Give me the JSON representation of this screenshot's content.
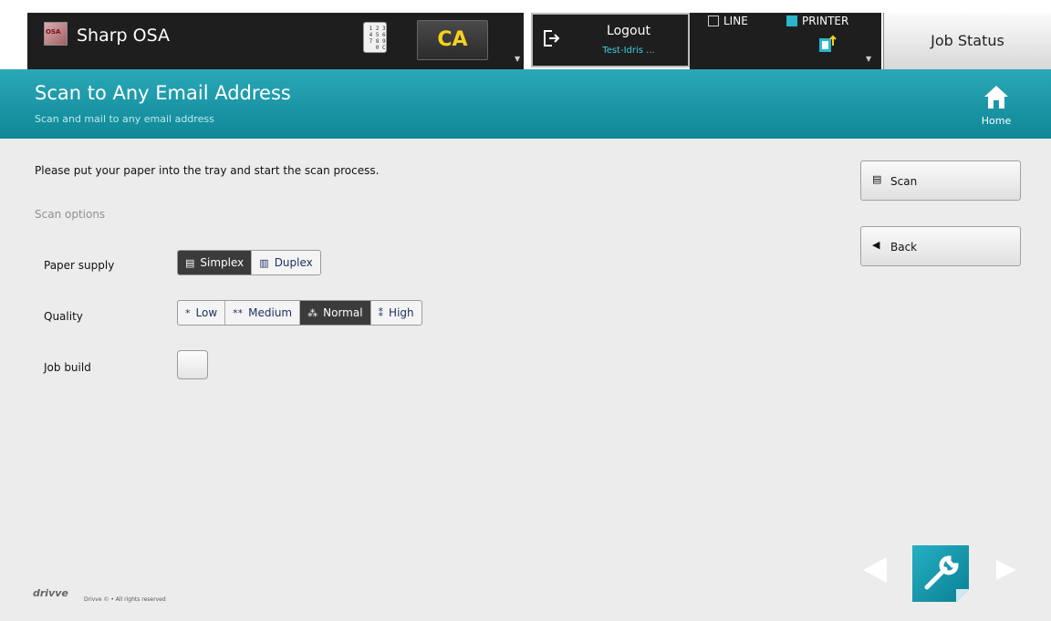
{
  "top_bar": {
    "app_title": "Sharp OSA",
    "app_logo_text": "OSA",
    "keypad_icon": "keypad-icon",
    "keypad_text": " 1 2 3\n 4 5 6\n 7 8 9\n   0 C",
    "ca_label": "CA",
    "logout_label": "Logout",
    "logout_user": "Test-Idris ...",
    "line_label": "LINE",
    "printer_label": "PRINTER",
    "job_status_label": "Job Status",
    "accent_colors": {
      "ca": "#f6d21d",
      "printer": "#2bb4cc",
      "user": "#3fd0e0"
    }
  },
  "header": {
    "title": "Scan to Any Email Address",
    "subtitle": "Scan and mail to any email address",
    "home_label": "Home",
    "background": "#1a97a7"
  },
  "main": {
    "instruction": "Please put your paper into the tray and start the scan process.",
    "section_title": "Scan options",
    "paper_supply": {
      "label": "Paper supply",
      "options": [
        "Simplex",
        "Duplex"
      ],
      "selected": "Simplex"
    },
    "quality": {
      "label": "Quality",
      "options": [
        "Low",
        "Medium",
        "Normal",
        "High"
      ],
      "glyphs": [
        "*",
        "**",
        "⁂",
        "⁑"
      ],
      "selected": "Normal"
    },
    "job_build": {
      "label": "Job build",
      "checked": false
    }
  },
  "actions": {
    "scan_label": "Scan",
    "back_label": "Back"
  },
  "footer": {
    "logo_text": "drivve",
    "copyright": "Drivve © • All rights reserved"
  }
}
